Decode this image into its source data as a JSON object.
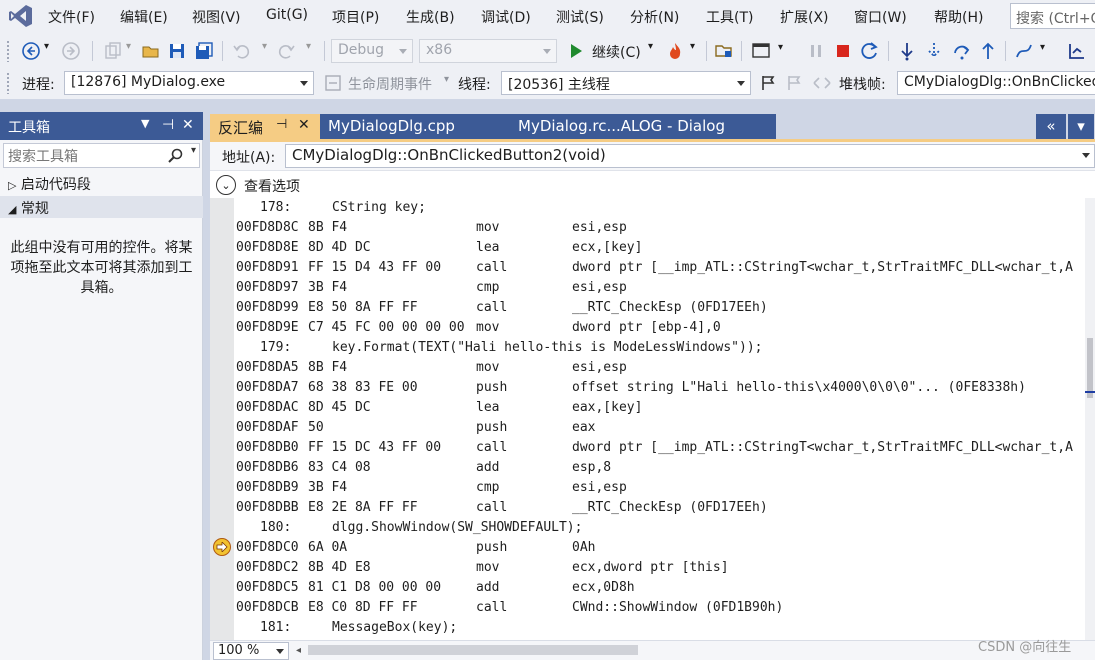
{
  "menu": {
    "items": [
      "文件(F)",
      "编辑(E)",
      "视图(V)",
      "Git(G)",
      "项目(P)",
      "生成(B)",
      "调试(D)",
      "测试(S)",
      "分析(N)",
      "工具(T)",
      "扩展(X)",
      "窗口(W)",
      "帮助(H)"
    ],
    "search_placeholder": "搜索 (Ctrl+Q)"
  },
  "toolbar": {
    "config": "Debug",
    "platform": "x86",
    "continue_label": "继续(C)",
    "process_label": "进程:",
    "process_value": "[12876] MyDialog.exe",
    "lifecycle_label": "生命周期事件",
    "thread_label": "线程:",
    "thread_value": "[20536] 主线程",
    "stackframe_label": "堆栈帧:",
    "stackframe_value": "CMyDialogDlg::OnBnClicked"
  },
  "toolbox": {
    "title": "工具箱",
    "search_placeholder": "搜索工具箱",
    "groups": [
      {
        "label": "启动代码段",
        "expanded": false
      },
      {
        "label": "常规",
        "expanded": true
      }
    ],
    "empty_message": "此组中没有可用的控件。将某项拖至此文本可将其添加到工具箱。"
  },
  "tabs": [
    {
      "label": "反汇编",
      "active": true
    },
    {
      "label": "MyDialogDlg.cpp",
      "active": false
    },
    {
      "label": "MyDialog.rc...ALOG - Dialog",
      "active": false
    }
  ],
  "address": {
    "label": "地址(A):",
    "value": "CMyDialogDlg::OnBnClickedButton2(void)"
  },
  "view_options_label": "查看选项",
  "code": [
    {
      "kind": "src",
      "num": "178:",
      "text": "CString key;"
    },
    {
      "kind": "asm",
      "addr": "00FD8D8C",
      "bytes": "8B F4",
      "mnem": "mov",
      "ops": "esi,esp"
    },
    {
      "kind": "asm",
      "addr": "00FD8D8E",
      "bytes": "8D 4D DC",
      "mnem": "lea",
      "ops": "ecx,[key]"
    },
    {
      "kind": "asm",
      "addr": "00FD8D91",
      "bytes": "FF 15 D4 43 FF 00",
      "mnem": "call",
      "ops": "dword ptr [__imp_ATL::CStringT<wchar_t,StrTraitMFC_DLL<wchar_t,A"
    },
    {
      "kind": "asm",
      "addr": "00FD8D97",
      "bytes": "3B F4",
      "mnem": "cmp",
      "ops": "esi,esp"
    },
    {
      "kind": "asm",
      "addr": "00FD8D99",
      "bytes": "E8 50 8A FF FF",
      "mnem": "call",
      "ops": "__RTC_CheckEsp (0FD17EEh)"
    },
    {
      "kind": "asm",
      "addr": "00FD8D9E",
      "bytes": "C7 45 FC 00 00 00 00",
      "mnem": "mov",
      "ops": "dword ptr [ebp-4],0"
    },
    {
      "kind": "src",
      "num": "179:",
      "text": "key.Format(TEXT(\"Hali hello-this is ModeLessWindows\"));"
    },
    {
      "kind": "asm",
      "addr": "00FD8DA5",
      "bytes": "8B F4",
      "mnem": "mov",
      "ops": "esi,esp"
    },
    {
      "kind": "asm",
      "addr": "00FD8DA7",
      "bytes": "68 38 83 FE 00",
      "mnem": "push",
      "ops": "offset string L\"Hali hello-this\\x4000\\0\\0\\0\"... (0FE8338h)"
    },
    {
      "kind": "asm",
      "addr": "00FD8DAC",
      "bytes": "8D 45 DC",
      "mnem": "lea",
      "ops": "eax,[key]"
    },
    {
      "kind": "asm",
      "addr": "00FD8DAF",
      "bytes": "50",
      "mnem": "push",
      "ops": "eax"
    },
    {
      "kind": "asm",
      "addr": "00FD8DB0",
      "bytes": "FF 15 DC 43 FF 00",
      "mnem": "call",
      "ops": "dword ptr [__imp_ATL::CStringT<wchar_t,StrTraitMFC_DLL<wchar_t,A"
    },
    {
      "kind": "asm",
      "addr": "00FD8DB6",
      "bytes": "83 C4 08",
      "mnem": "add",
      "ops": "esp,8"
    },
    {
      "kind": "asm",
      "addr": "00FD8DB9",
      "bytes": "3B F4",
      "mnem": "cmp",
      "ops": "esi,esp"
    },
    {
      "kind": "asm",
      "addr": "00FD8DBB",
      "bytes": "E8 2E 8A FF FF",
      "mnem": "call",
      "ops": "__RTC_CheckEsp (0FD17EEh)"
    },
    {
      "kind": "src",
      "num": "180:",
      "text": "dlgg.ShowWindow(SW_SHOWDEFAULT);"
    },
    {
      "kind": "asm",
      "addr": "00FD8DC0",
      "bytes": "6A 0A",
      "mnem": "push",
      "ops": "0Ah",
      "current": true
    },
    {
      "kind": "asm",
      "addr": "00FD8DC2",
      "bytes": "8B 4D E8",
      "mnem": "mov",
      "ops": "ecx,dword ptr [this]"
    },
    {
      "kind": "asm",
      "addr": "00FD8DC5",
      "bytes": "81 C1 D8 00 00 00",
      "mnem": "add",
      "ops": "ecx,0D8h"
    },
    {
      "kind": "asm",
      "addr": "00FD8DCB",
      "bytes": "E8 C0 8D FF FF",
      "mnem": "call",
      "ops": "CWnd::ShowWindow (0FD1B90h)"
    },
    {
      "kind": "src",
      "num": "181:",
      "text": "MessageBox(key);"
    }
  ],
  "zoom": "100 %",
  "watermark": "CSDN @向往生"
}
